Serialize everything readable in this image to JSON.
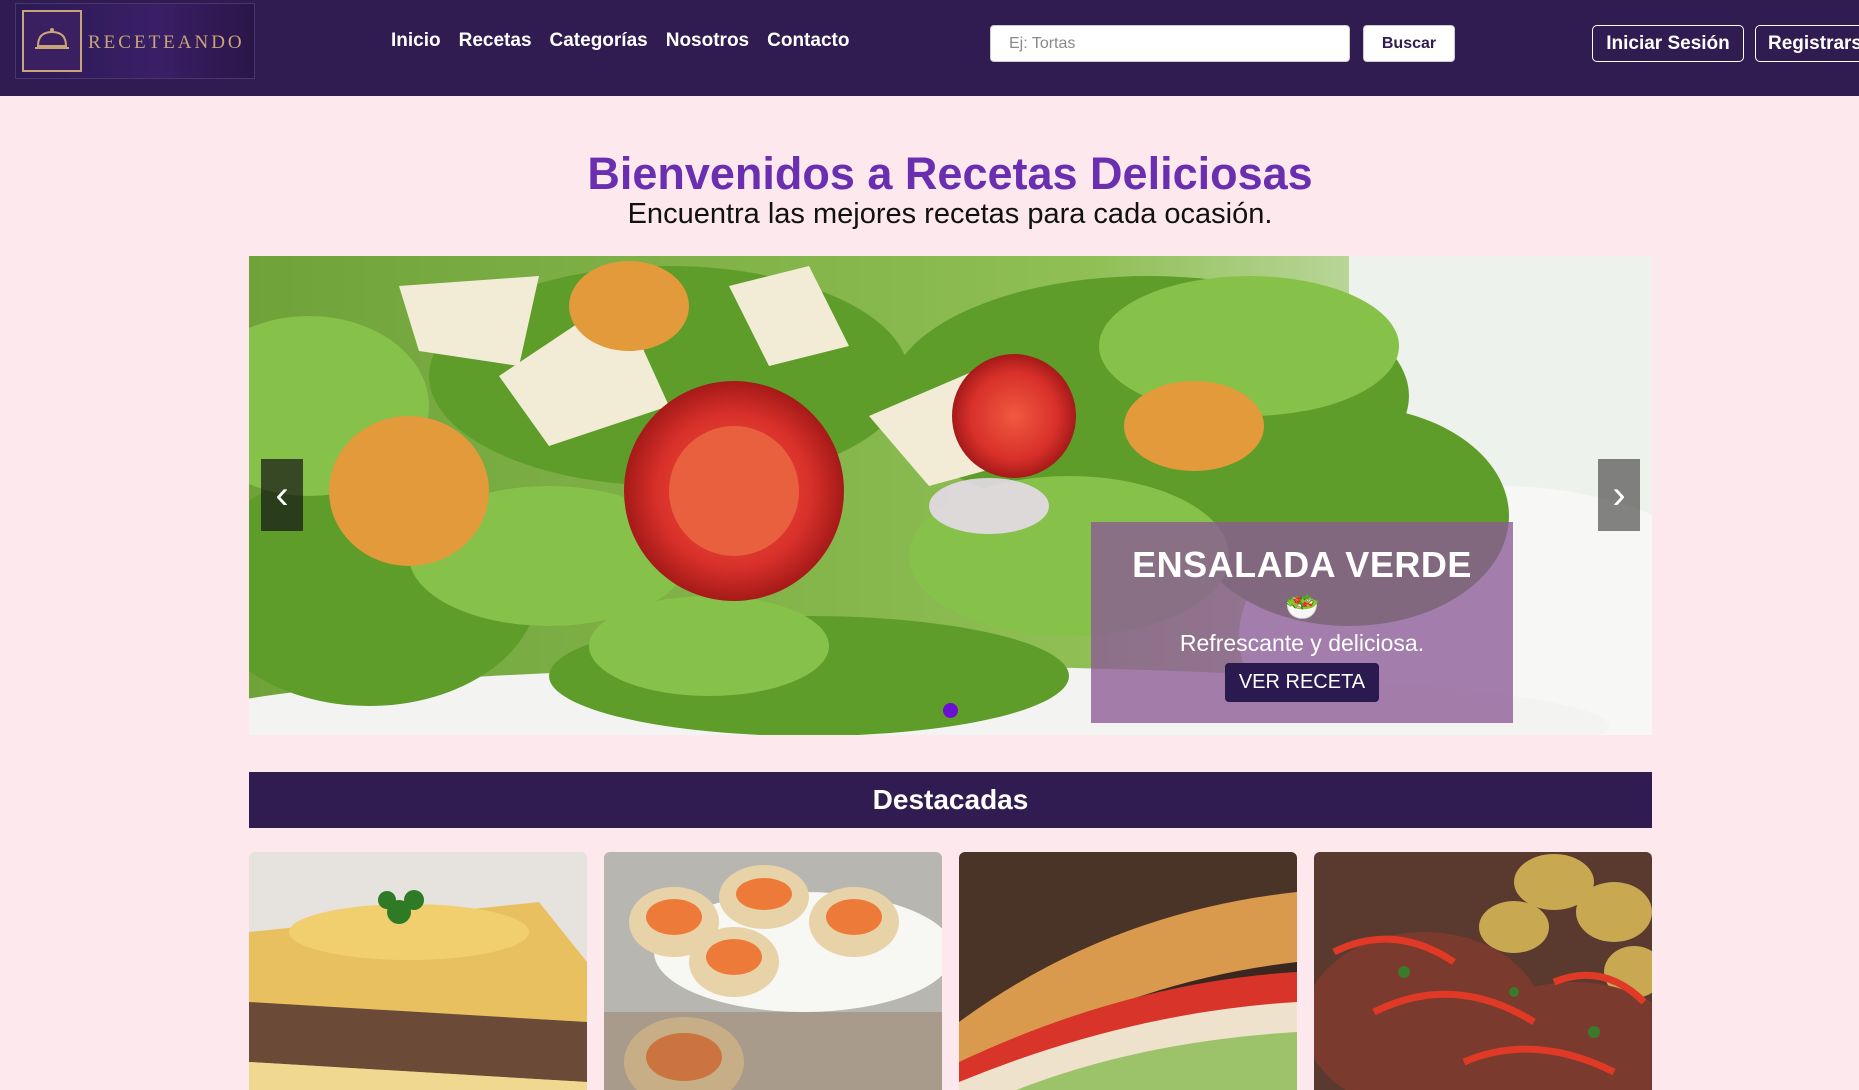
{
  "brand": {
    "name": "RECETEANDO"
  },
  "nav": {
    "links": [
      "Inicio",
      "Recetas",
      "Categorías",
      "Nosotros",
      "Contacto"
    ]
  },
  "search": {
    "placeholder": "Ej: Tortas",
    "button": "Buscar"
  },
  "auth": {
    "login": "Iniciar Sesión",
    "register": "Registrarse"
  },
  "hero": {
    "title": "Bienvenidos a Recetas Deliciosas",
    "subtitle": "Encuentra las mejores recetas para cada ocasión."
  },
  "carousel": {
    "prev_glyph": "‹",
    "next_glyph": "›",
    "slide": {
      "title": "ENSALADA VERDE",
      "emoji": "🥗",
      "description": "Refrescante y deliciosa.",
      "button": "VER RECETA"
    },
    "active_index": 0,
    "slide_count": 1
  },
  "featured": {
    "heading": "Destacadas",
    "cards": [
      {
        "image": "pastel-de-papa-photo"
      },
      {
        "image": "canastitas-photo"
      },
      {
        "image": "sandwich-photo"
      },
      {
        "image": "carne-con-papas-photo"
      }
    ]
  },
  "colors": {
    "navbar": "#301c50",
    "page_bg": "#fde8ee",
    "accent_title": "#6a2fb0",
    "caption_overlay": "#8c5a96",
    "active_dot": "#6a10d0"
  }
}
